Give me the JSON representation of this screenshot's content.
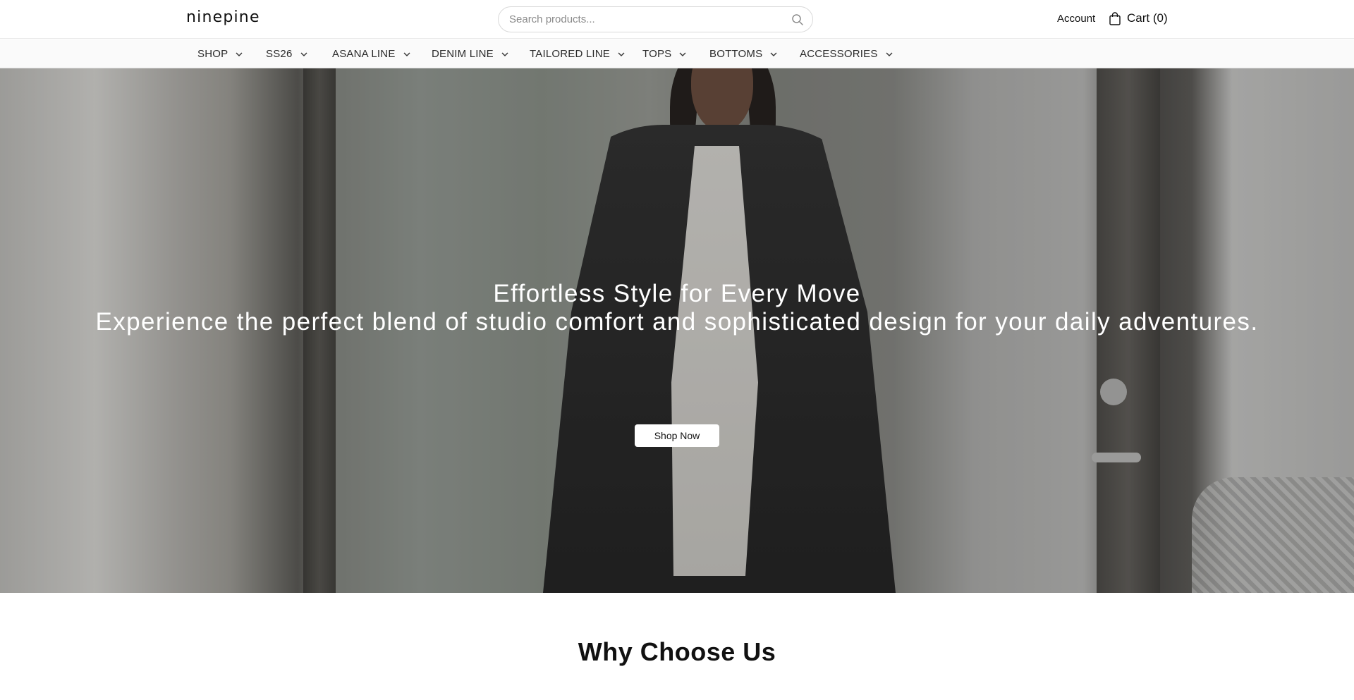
{
  "header": {
    "logo": "ninepine",
    "search": {
      "placeholder": "Search products..."
    },
    "account_label": "Account",
    "cart_label": "Cart (0)"
  },
  "nav": {
    "items": [
      {
        "label": "SHOP"
      },
      {
        "label": "SS26"
      },
      {
        "label": "ASANA LINE"
      },
      {
        "label": "DENIM LINE"
      },
      {
        "label": "TAILORED LINE"
      },
      {
        "label": "TOPS"
      },
      {
        "label": "BOTTOMS"
      },
      {
        "label": "ACCESSORIES"
      }
    ]
  },
  "hero": {
    "title": "Effortless Style for Every Move",
    "subtitle": "Experience the perfect blend of studio comfort and sophisticated design for your daily adventures.",
    "cta_label": "Shop Now"
  },
  "section": {
    "title": "Why Choose Us"
  },
  "icons": {
    "search": "search-icon",
    "cart": "shopping-bag-icon",
    "dropdown": "chevron-down-icon"
  },
  "colors": {
    "text": "#111111",
    "nav_bg": "#fafafa",
    "hero_text": "#ffffff",
    "button_bg": "#ffffff"
  }
}
